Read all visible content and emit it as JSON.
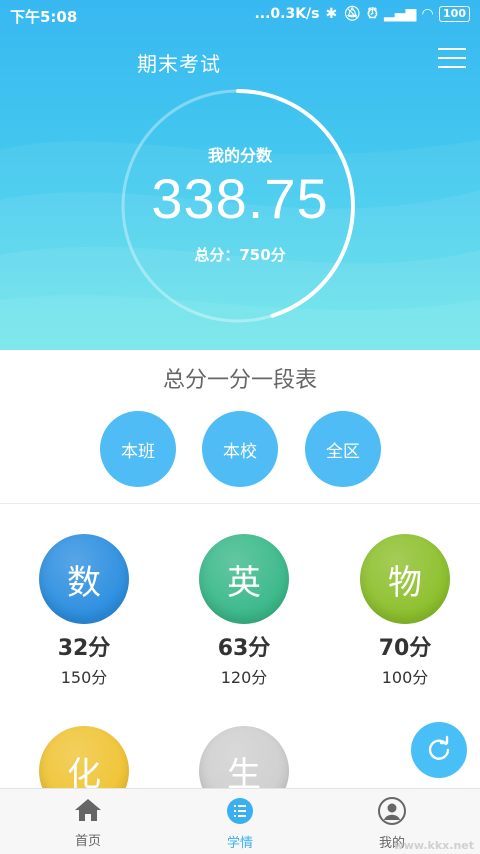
{
  "status_bar": {
    "time": "下午5:08",
    "network_speed": "...0.3K/s",
    "battery": "100"
  },
  "header": {
    "title": "期末考试",
    "score_label": "我的分数",
    "score": "338.75",
    "total": "总分：750分",
    "progress_fraction": 0.4517
  },
  "ranking": {
    "title": "总分一分一段表",
    "buttons": [
      "本班",
      "本校",
      "全区"
    ]
  },
  "subjects": [
    {
      "char": "数",
      "score": "32分",
      "full": "150分",
      "color": "#2d8fe0"
    },
    {
      "char": "英",
      "score": "63分",
      "full": "120分",
      "color": "#3bb98a"
    },
    {
      "char": "物",
      "score": "70分",
      "full": "100分",
      "color": "#8dc02d"
    },
    {
      "char": "化",
      "score": "",
      "full": "",
      "color": "#f0c435"
    },
    {
      "char": "生",
      "score": "",
      "full": "",
      "color": "#cfcfcf"
    }
  ],
  "nav": {
    "home": "首页",
    "study": "学情",
    "mine": "我的",
    "active_color": "#3ab0f0"
  },
  "watermark": "www.kkx.net"
}
